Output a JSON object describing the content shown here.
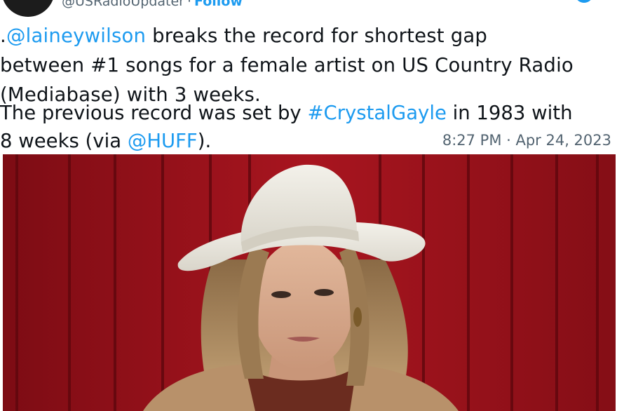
{
  "header": {
    "handle": "@USRadioUpdater",
    "separator": "·",
    "follow_label": "Follow"
  },
  "tweet": {
    "line1_prefix": ".",
    "line1_mention": "@laineywilson",
    "line1_rest": " breaks the record for shortest gap",
    "line2": "between #1 songs for a female artist on US Country Radio",
    "line3": "(Mediabase) with 3 weeks.",
    "line4_text": "The previous record was set by ",
    "line4_hashtag": "#CrystalGayle",
    "line4_rest": " in 1983 with",
    "line5_text": "8 weeks (via ",
    "line5_mention": "@HUFF",
    "line5_rest": ")."
  },
  "timestamp": "8:27 PM · Apr 24, 2023",
  "colors": {
    "link": "#1d9bf0",
    "barn_red": "#a3141f",
    "hat": "#ece9e0"
  },
  "icons": [
    "avatar",
    "twitter-logo-icon"
  ]
}
